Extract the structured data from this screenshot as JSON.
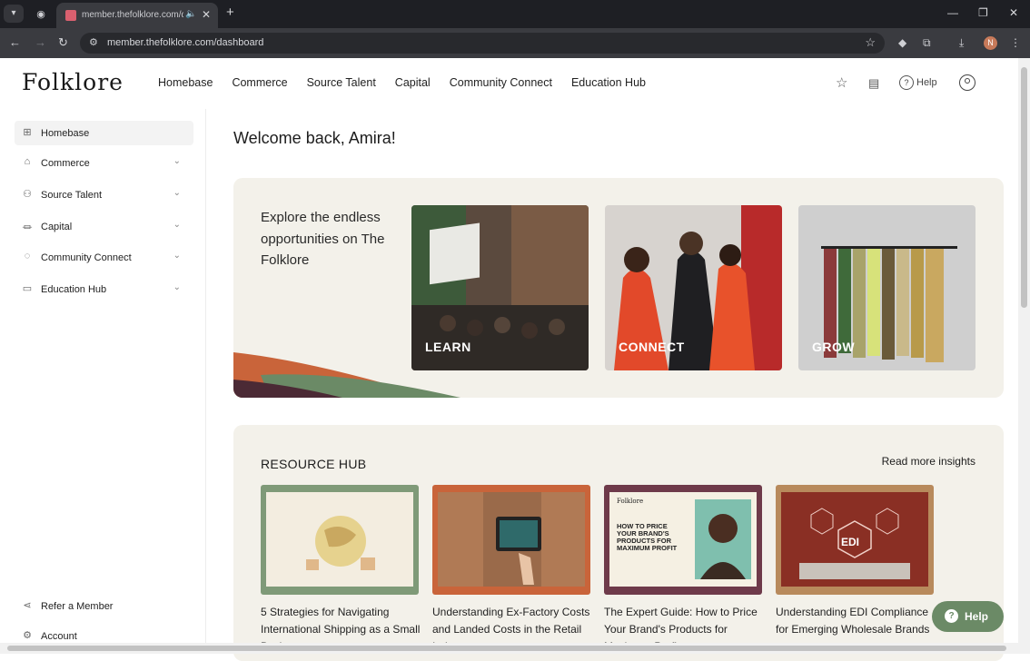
{
  "browser": {
    "tab_title": "member.thefolklore.com/d",
    "url": "member.thefolklore.com/dashboard",
    "profile_initial": "N"
  },
  "header": {
    "logo": "Folklore",
    "nav": [
      "Homebase",
      "Commerce",
      "Source Talent",
      "Capital",
      "Community Connect",
      "Education Hub"
    ],
    "help_label": "Help"
  },
  "sidebar": {
    "items": [
      {
        "label": "Homebase",
        "icon": "grid-icon"
      },
      {
        "label": "Commerce",
        "icon": "store-icon"
      },
      {
        "label": "Source Talent",
        "icon": "people-icon"
      },
      {
        "label": "Capital",
        "icon": "bank-icon"
      },
      {
        "label": "Community Connect",
        "icon": "chat-icon"
      },
      {
        "label": "Education Hub",
        "icon": "book-icon"
      }
    ],
    "bottom": [
      {
        "label": "Refer a Member",
        "icon": "share-icon"
      },
      {
        "label": "Account",
        "icon": "gear-icon"
      }
    ]
  },
  "main": {
    "welcome": "Welcome back, Amira!",
    "hero": {
      "text": "Explore the endless opportunities on The Folklore",
      "tiles": [
        "LEARN",
        "CONNECT",
        "GROW"
      ]
    },
    "resource_hub": {
      "title": "RESOURCE HUB",
      "more_link": "Read more insights",
      "cards": [
        {
          "title": "5 Strategies for Navigating International Shipping as a Small Business",
          "frame_color": "#7f9a78"
        },
        {
          "title": "Understanding Ex-Factory Costs and Landed Costs in the Retail Industry",
          "frame_color": "#c9643a"
        },
        {
          "title": "The Expert Guide: How to Price Your Brand's Products for Maximum Profit",
          "frame_color": "#6e3a4a"
        },
        {
          "title": "Understanding EDI Compliance for Emerging Wholesale Brands",
          "frame_color": "#b88a5c"
        }
      ],
      "card3_inner": {
        "brand": "Folklore",
        "headline": "HOW TO PRICE YOUR BRAND'S PRODUCTS FOR MAXIMUM PROFIT"
      },
      "card4_inner": "EDI"
    }
  },
  "help_fab": "Help",
  "colors": {
    "accent_green": "#6b8a66",
    "hero_bg": "#f3f1ea",
    "swoosh_orange": "#c9643a"
  }
}
